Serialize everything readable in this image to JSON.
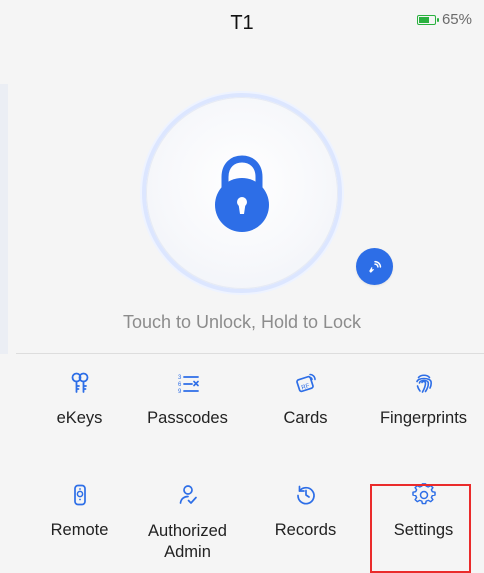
{
  "header": {
    "title": "T1",
    "battery_text": "65%",
    "battery_level": 0.65
  },
  "lock": {
    "caption": "Touch to Unlock, Hold to Lock",
    "main_icon": "padlock-keyhole-icon",
    "badge_icon": "nfc-key-icon"
  },
  "menu": {
    "row1": [
      {
        "label": "eKeys",
        "icon": "ekey-icon"
      },
      {
        "label": "Passcodes",
        "icon": "passcode-icon"
      },
      {
        "label": "Cards",
        "icon": "rf-card-icon"
      },
      {
        "label": "Fingerprints",
        "icon": "fingerprint-icon"
      }
    ],
    "row2": [
      {
        "label": "Remote",
        "icon": "remote-icon"
      },
      {
        "label": "Authorized Admin",
        "icon": "admin-icon"
      },
      {
        "label": "Records",
        "icon": "history-icon"
      },
      {
        "label": "Settings",
        "icon": "gear-icon"
      }
    ]
  },
  "colors": {
    "accent": "#2d6ee7",
    "highlight": "#ea2b2b",
    "battery": "#2ab13f"
  }
}
